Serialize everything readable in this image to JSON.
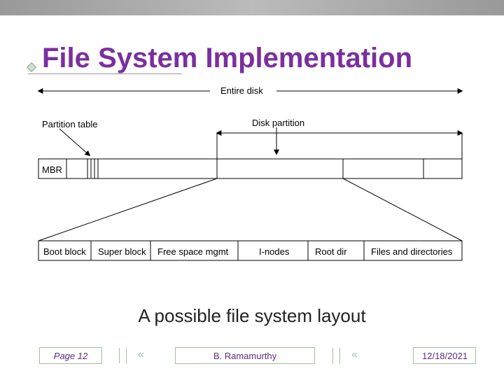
{
  "title": "File System Implementation",
  "diagram": {
    "top_label": "Entire disk",
    "labels": {
      "partition_table": "Partition table",
      "disk_partition": "Disk partition"
    },
    "disk_bar": {
      "mbr": "MBR"
    },
    "fs_bar": {
      "boot": "Boot block",
      "super": "Super block",
      "free": "Free space mgmt",
      "inodes": "I-nodes",
      "root": "Root dir",
      "files": "Files and directories"
    }
  },
  "caption": "A possible file system layout",
  "footer": {
    "page": "Page 12",
    "author": "B. Ramamurthy",
    "date": "12/18/2021"
  }
}
